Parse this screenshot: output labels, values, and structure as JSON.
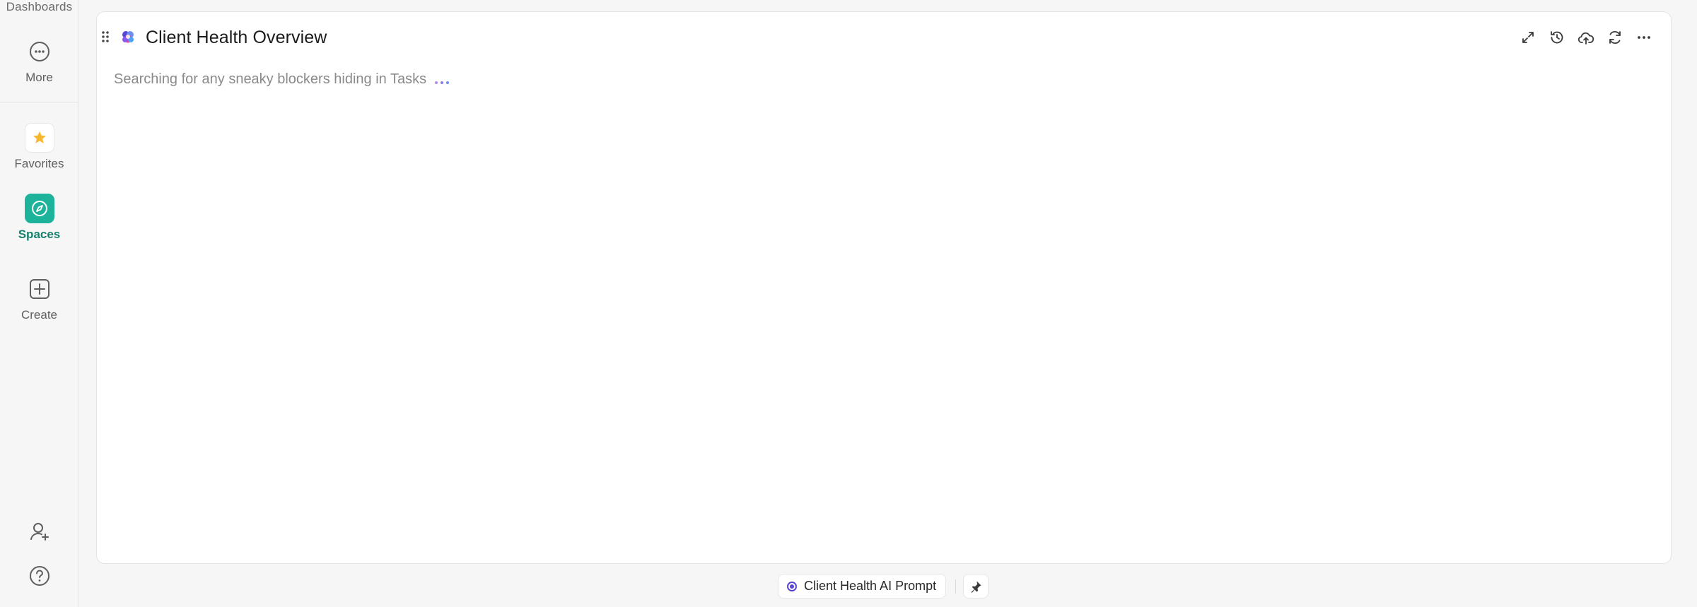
{
  "sidebar": {
    "top_label": "Dashboards",
    "items": [
      {
        "label": "More",
        "icon": "more-circle-icon"
      },
      {
        "label": "Favorites",
        "icon": "star-icon"
      },
      {
        "label": "Spaces",
        "icon": "compass-icon"
      },
      {
        "label": "Create",
        "icon": "plus-square-icon"
      }
    ],
    "bottom_icons": [
      "invite-user-icon",
      "help-icon"
    ]
  },
  "card": {
    "title": "Client Health Overview",
    "status_text": "Searching for any sneaky blockers hiding in Tasks",
    "actions": [
      "expand-icon",
      "history-icon",
      "cloud-upload-icon",
      "refresh-icon",
      "more-icon"
    ]
  },
  "bottom_bar": {
    "tab_label": "Client Health AI Prompt",
    "pin_icon": "pin-icon"
  },
  "colors": {
    "accent_spaces": "#1db39b",
    "star": "#f5b82e",
    "ai_purple": "#5a46d6",
    "ai_pink": "#e0457b"
  }
}
